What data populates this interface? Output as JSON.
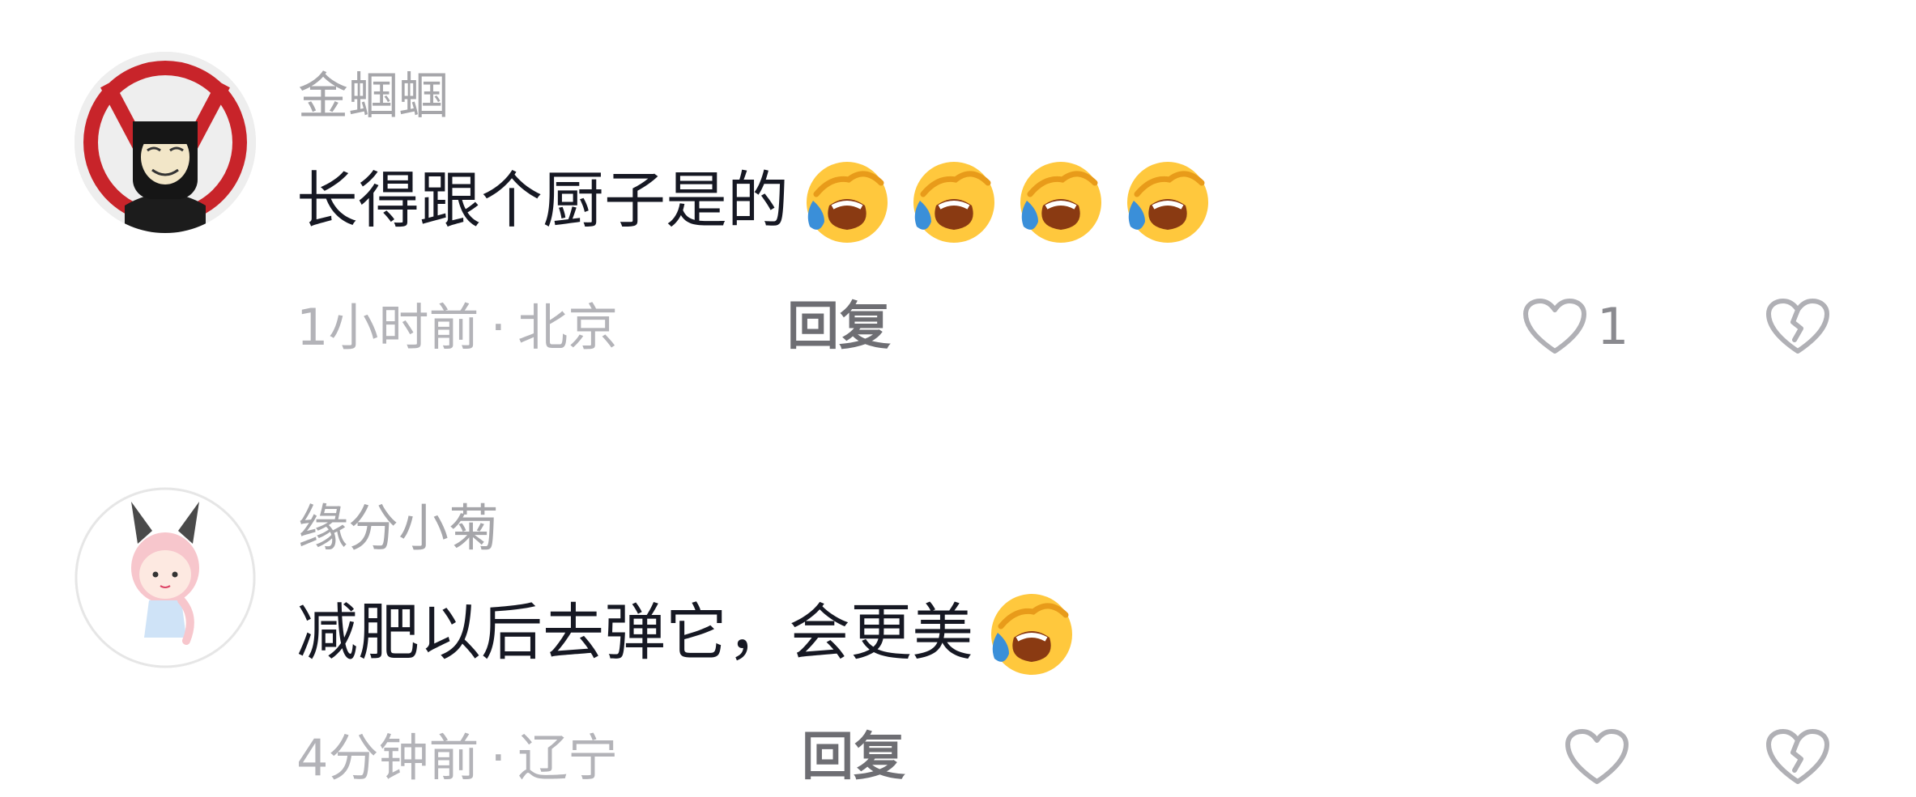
{
  "comments": [
    {
      "username": "金蝈蝈",
      "text": "长得跟个厨子是的",
      "emoji_count": 4,
      "emoji_name": "rofl-emoji",
      "time": "1小时前",
      "location": "北京",
      "separator": "·",
      "reply_label": "回复",
      "like_count": "1"
    },
    {
      "username": "缘分小菊",
      "text": "减肥以后去弹它，会更美",
      "emoji_count": 1,
      "emoji_name": "rofl-emoji",
      "time": "4分钟前",
      "location": "辽宁",
      "separator": "·",
      "reply_label": "回复",
      "like_count": ""
    }
  ],
  "icons": {
    "like": "heart-outline-icon",
    "dislike": "broken-heart-icon"
  },
  "colors": {
    "username": "#a6a6aa",
    "body": "#161823",
    "meta": "#b3b3b8",
    "reply": "#6e6e73",
    "icon": "#8a8a8f"
  }
}
